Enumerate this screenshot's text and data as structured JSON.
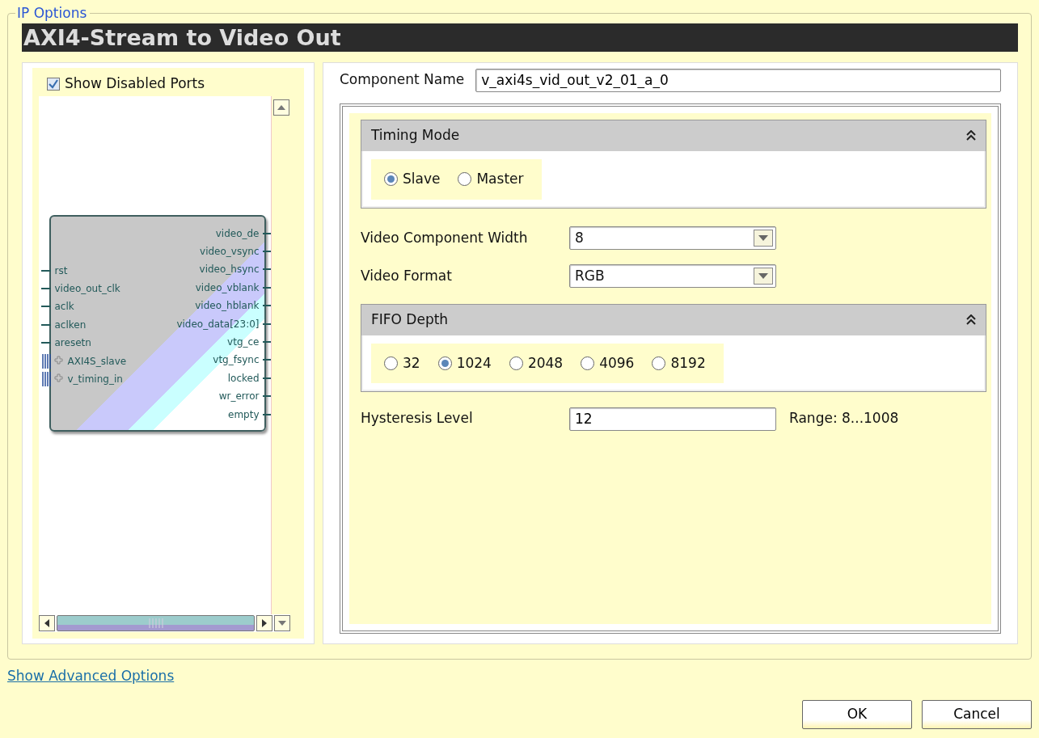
{
  "panel_title": "IP Options",
  "header": "AXI4-Stream to Video Out",
  "show_disabled_ports": {
    "label": "Show Disabled Ports",
    "checked": true
  },
  "block": {
    "inputs": [
      {
        "name": "rst",
        "kind": "pin"
      },
      {
        "name": "video_out_clk",
        "kind": "pin"
      },
      {
        "name": "aclk",
        "kind": "pin"
      },
      {
        "name": "aclken",
        "kind": "pin"
      },
      {
        "name": "aresetn",
        "kind": "pin"
      },
      {
        "name": "AXI4S_slave",
        "kind": "bus"
      },
      {
        "name": "v_timing_in",
        "kind": "bus"
      }
    ],
    "outputs": [
      {
        "name": "video_de",
        "kind": "pin"
      },
      {
        "name": "video_vsync",
        "kind": "pin"
      },
      {
        "name": "video_hsync",
        "kind": "pin"
      },
      {
        "name": "video_vblank",
        "kind": "pin"
      },
      {
        "name": "video_hblank",
        "kind": "pin"
      },
      {
        "name": "video_data[23:0]",
        "kind": "pin"
      },
      {
        "name": "vtg_ce",
        "kind": "pin"
      },
      {
        "name": "vtg_fsync",
        "kind": "pin"
      },
      {
        "name": "locked",
        "kind": "pin"
      },
      {
        "name": "wr_error",
        "kind": "pin"
      },
      {
        "name": "empty",
        "kind": "pin"
      }
    ]
  },
  "component_name": {
    "label": "Component Name",
    "value": "v_axi4s_vid_out_v2_01_a_0"
  },
  "sections": [
    {
      "kind": "group",
      "title": "Timing Mode",
      "options": [
        {
          "label": "Slave",
          "selected": true
        },
        {
          "label": "Master",
          "selected": false
        }
      ]
    },
    {
      "kind": "dropdown",
      "label": "Video Component Width",
      "value": "8"
    },
    {
      "kind": "dropdown",
      "label": "Video Format",
      "value": "RGB"
    },
    {
      "kind": "group",
      "title": "FIFO Depth",
      "options": [
        {
          "label": "32",
          "selected": false
        },
        {
          "label": "1024",
          "selected": true
        },
        {
          "label": "2048",
          "selected": false
        },
        {
          "label": "4096",
          "selected": false
        },
        {
          "label": "8192",
          "selected": false
        }
      ]
    },
    {
      "kind": "text",
      "label": "Hysteresis Level",
      "value": "12",
      "range": "Range: 8...1008"
    }
  ],
  "advanced_link": "Show Advanced Options",
  "buttons": [
    "OK",
    "Cancel"
  ]
}
